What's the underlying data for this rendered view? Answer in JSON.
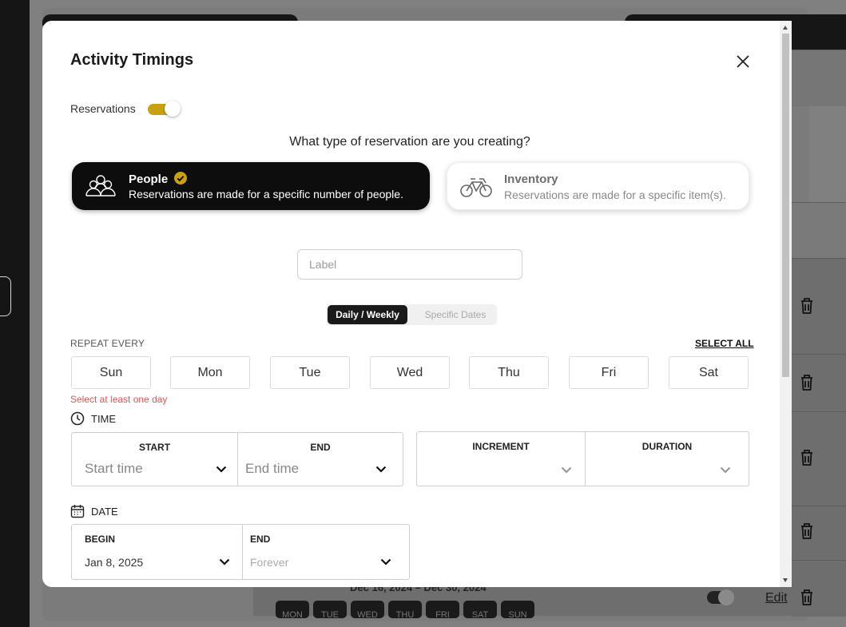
{
  "modal": {
    "title": "Activity Timings",
    "reservations_label": "Reservations",
    "reservations_on": true,
    "question": "What type of reservation are you creating?",
    "types": [
      {
        "name": "People",
        "description": "Reservations are made for a specific number of people.",
        "selected": true,
        "icon": "people-group-icon"
      },
      {
        "name": "Inventory",
        "description": "Reservations are made for a specific item(s).",
        "selected": false,
        "icon": "bicycle-icon"
      }
    ],
    "label_placeholder": "Label",
    "schedule_tabs": [
      {
        "label": "Daily / Weekly",
        "active": true
      },
      {
        "label": "Specific Dates",
        "active": false
      }
    ],
    "repeat_label": "REPEAT EVERY",
    "select_all_label": "SELECT ALL",
    "days": [
      "Sun",
      "Mon",
      "Tue",
      "Wed",
      "Thu",
      "Fri",
      "Sat"
    ],
    "error_text": "Select at least one day",
    "time": {
      "label": "TIME",
      "start_label": "START",
      "start_placeholder": "Start time",
      "end_label": "END",
      "end_placeholder": "End time",
      "increment_label": "INCREMENT",
      "duration_label": "DURATION"
    },
    "date": {
      "label": "DATE",
      "begin_label": "BEGIN",
      "begin_value": "Jan 8, 2025",
      "end_label": "END",
      "end_value": "Forever"
    }
  },
  "background": {
    "date_range": "Dec 16, 2024 – Dec 30, 2024",
    "weekdays": [
      "MON",
      "TUE",
      "WED",
      "THU",
      "FRI",
      "SAT",
      "SUN"
    ],
    "edit_label": "Edit"
  },
  "colors": {
    "accent": "#c8a20c",
    "dark": "#0d0d0d",
    "error": "#e05656"
  }
}
